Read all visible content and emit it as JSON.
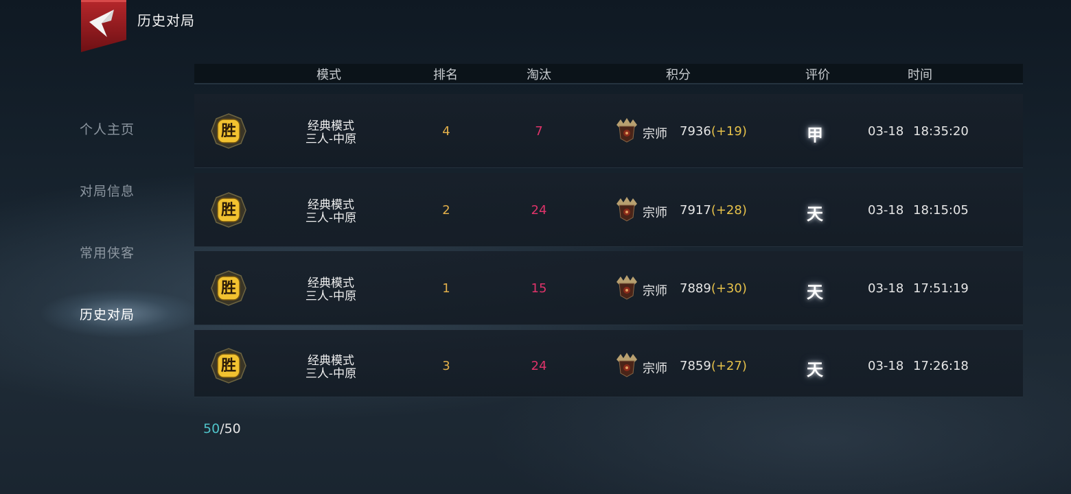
{
  "header": {
    "title": "历史对局",
    "back_icon": "back-arrow-icon",
    "accent_color": "#9b1c1c"
  },
  "sidebar": {
    "items": [
      {
        "label": "个人主页",
        "active": false
      },
      {
        "label": "对局信息",
        "active": false
      },
      {
        "label": "常用侠客",
        "active": false
      },
      {
        "label": "历史对局",
        "active": true
      }
    ]
  },
  "table": {
    "columns": [
      "模式",
      "排名",
      "淘汰",
      "积分",
      "评价",
      "时间"
    ],
    "rows": [
      {
        "result": "胜",
        "mode_line1": "经典模式",
        "mode_line2": "三人-中原",
        "rank": "4",
        "eliminations": "7",
        "tier": "宗师",
        "score": "7936",
        "delta": "(+19)",
        "rating": "甲",
        "date": "03-18",
        "clock": "18:35:20"
      },
      {
        "result": "胜",
        "mode_line1": "经典模式",
        "mode_line2": "三人-中原",
        "rank": "2",
        "eliminations": "24",
        "tier": "宗师",
        "score": "7917",
        "delta": "(+28)",
        "rating": "天",
        "date": "03-18",
        "clock": "18:15:05"
      },
      {
        "result": "胜",
        "mode_line1": "经典模式",
        "mode_line2": "三人-中原",
        "rank": "1",
        "eliminations": "15",
        "tier": "宗师",
        "score": "7889",
        "delta": "(+30)",
        "rating": "天",
        "date": "03-18",
        "clock": "17:51:19"
      },
      {
        "result": "胜",
        "mode_line1": "经典模式",
        "mode_line2": "三人-中原",
        "rank": "3",
        "eliminations": "24",
        "tier": "宗师",
        "score": "7859",
        "delta": "(+27)",
        "rating": "天",
        "date": "03-18",
        "clock": "17:26:18"
      }
    ]
  },
  "pager": {
    "current": "50",
    "separator": "/",
    "total": "50"
  },
  "colors": {
    "rank": "#e3b04a",
    "eliminations": "#e0336a",
    "delta": "#e7c24a",
    "pager_current": "#4fc3c9",
    "badge_gold": "#f2c230"
  },
  "icons": {
    "result_badge": "victory-badge-icon",
    "tier": "grandmaster-tier-icon"
  }
}
